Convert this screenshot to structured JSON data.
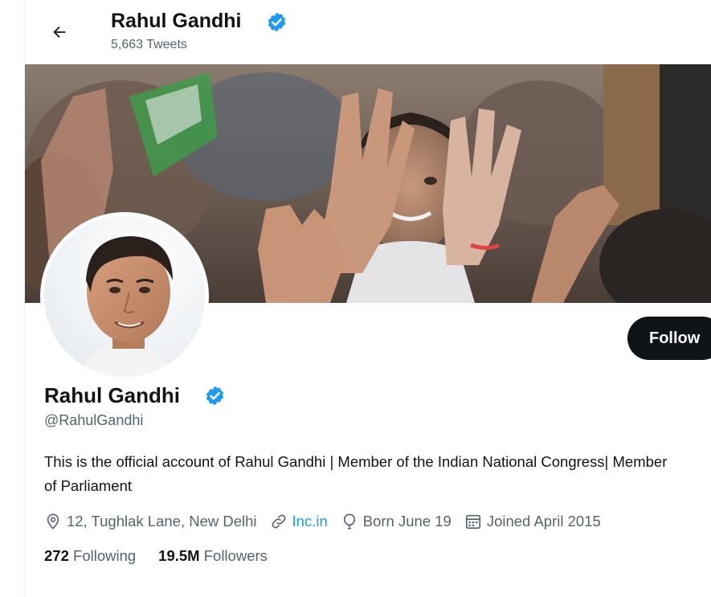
{
  "header": {
    "name": "Rahul Gandhi",
    "tweet_count": "5,663 Tweets",
    "back_icon": "arrow-left-icon"
  },
  "profile": {
    "name": "Rahul Gandhi",
    "handle": "@RahulGandhi",
    "verified_icon": "verified-badge-icon",
    "bio": "This is the official account of Rahul Gandhi | Member of the Indian National Congress| Member of Parliament",
    "location": "12, Tughlak Lane, New Delhi",
    "website": "Inc.in",
    "birthday": "Born June 19",
    "joined": "Joined April 2015"
  },
  "actions": {
    "follow_label": "Follow"
  },
  "stats": {
    "following_count": "272",
    "following_label": "Following",
    "followers_count": "19.5M",
    "followers_label": "Followers"
  },
  "colors": {
    "accent": "#1d9bf0",
    "text_primary": "#0f1419",
    "text_secondary": "#536471",
    "button_dark": "#0f1419"
  }
}
